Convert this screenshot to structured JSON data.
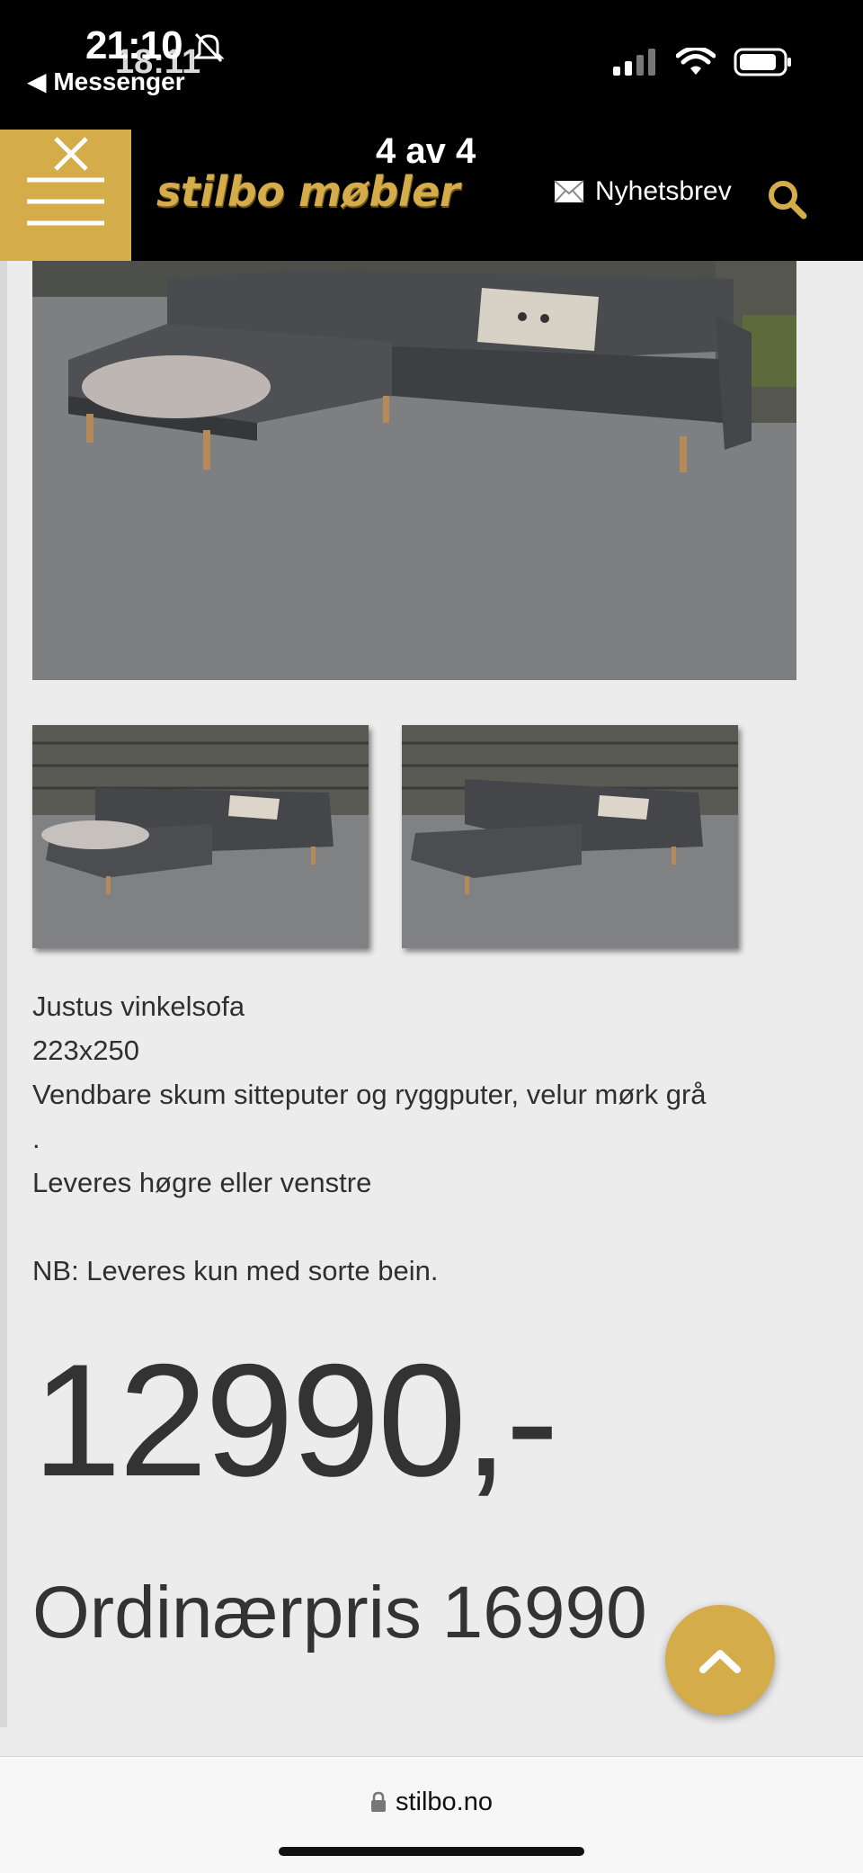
{
  "status_bar": {
    "time_primary": "21:10",
    "time_overlay": "18:11",
    "back_app": "◀ Messenger"
  },
  "header": {
    "page_counter": "4 av 4",
    "logo": "stilbo møbler",
    "newsletter_label": "Nyhetsbrev",
    "accent_color": "#d4ac4a"
  },
  "product": {
    "description_lines": [
      "Justus vinkelsofa",
      "223x250",
      "Vendbare skum sitteputer og ryggputer, velur mørk grå",
      ".",
      "Leveres høgre eller venstre",
      "",
      "NB: Leveres kun med sorte bein."
    ],
    "price": "12990,-",
    "ordinary_price": "Ordinærpris 16990"
  },
  "browser": {
    "url": "stilbo.no"
  }
}
